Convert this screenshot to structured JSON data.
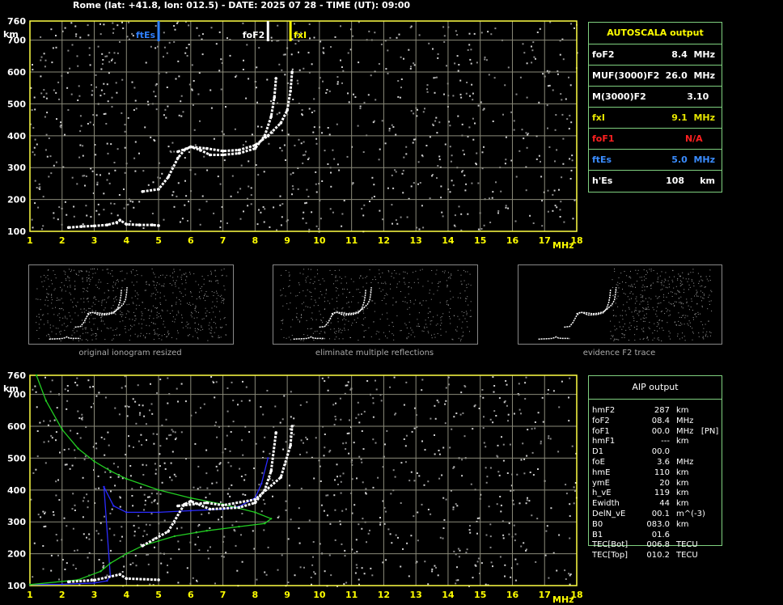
{
  "header": "Rome (lat: +41.8, lon: 012.5) - DATE: 2025 07 28 - TIME (UT): 09:00",
  "axis": {
    "x_unit": "MHz",
    "y_unit": "km",
    "x_ticks": [
      "1",
      "2",
      "3",
      "4",
      "5",
      "6",
      "7",
      "8",
      "9",
      "10",
      "11",
      "12",
      "13",
      "14",
      "15",
      "16",
      "17",
      "18"
    ],
    "y_ticks": [
      "100",
      "200",
      "300",
      "400",
      "500",
      "600",
      "700",
      "760"
    ]
  },
  "markers": {
    "ftEs": {
      "label": "ftEs",
      "freq": 5.0,
      "color": "#2f7fff"
    },
    "foF2": {
      "label": "foF2",
      "freq": 8.4,
      "color": "#ffffff"
    },
    "fxI": {
      "label": "fxI",
      "freq": 9.1,
      "color": "#ffff00"
    }
  },
  "autoscala": {
    "title": "AUTOSCALA output",
    "rows": [
      {
        "label": "foF2",
        "value": "8.4  MHz",
        "color": "#ffffff"
      },
      {
        "label": "MUF(3000)F2",
        "value": "26.0  MHz",
        "color": "#ffffff"
      },
      {
        "label": "M(3000)F2",
        "value": "3.10  ",
        "color": "#ffffff"
      },
      {
        "label": "fxI",
        "value": "9.1  MHz",
        "color": "#e6e600"
      },
      {
        "label": "foF1",
        "value": "N/A    ",
        "color": "#ff2020"
      },
      {
        "label": "ftEs",
        "value": "5.0  MHz",
        "color": "#3a8cff"
      },
      {
        "label": "h'Es",
        "value": "108     km",
        "color": "#ffffff"
      }
    ]
  },
  "thumbnails": [
    {
      "caption": "original ionogram resized"
    },
    {
      "caption": "eliminate multiple reflections"
    },
    {
      "caption": "evidence F2 trace"
    }
  ],
  "aip": {
    "title": "AIP output",
    "rows": [
      [
        "hmF2",
        "287",
        "km"
      ],
      [
        "foF2",
        "08.4",
        "MHz"
      ],
      [
        "foF1",
        "00.0",
        "MHz   [PN]"
      ],
      [
        "hmF1",
        "---",
        "km"
      ],
      [
        "D1",
        "00.0",
        ""
      ],
      [
        "foE",
        "3.6",
        "MHz"
      ],
      [
        "hmE",
        "110",
        "km"
      ],
      [
        "ymE",
        "20",
        "km"
      ],
      [
        "h_vE",
        "119",
        "km"
      ],
      [
        "Ewidth",
        "44",
        "km"
      ],
      [
        "DelN_vE",
        "00.1",
        "m^(-3)"
      ],
      [
        "B0",
        "083.0",
        "km"
      ],
      [
        "B1",
        "01.6",
        ""
      ],
      [
        "TEC[Bot]",
        "006.8",
        "TECU"
      ],
      [
        "TEC[Top]",
        "010.2",
        "TECU"
      ]
    ]
  },
  "chart_data": [
    {
      "type": "scatter",
      "title": "Rome (lat: +41.8, lon: 012.5) - DATE: 2025 07 28 - TIME (UT): 09:00",
      "xlabel": "MHz",
      "ylabel": "km",
      "xlim": [
        1,
        18
      ],
      "ylim": [
        100,
        760
      ],
      "grid": true,
      "series": [
        {
          "values": [
            [
              2.2,
              112
            ],
            [
              2.6,
              115
            ],
            [
              3.0,
              117
            ],
            [
              3.4,
              120
            ],
            [
              3.7,
              128
            ],
            [
              3.8,
              135
            ],
            [
              4.0,
              122
            ],
            [
              4.4,
              120
            ],
            [
              4.8,
              120
            ],
            [
              5.0,
              118
            ]
          ]
        },
        {
          "values": [
            [
              4.5,
              225
            ],
            [
              5.0,
              232
            ],
            [
              5.3,
              270
            ],
            [
              5.6,
              330
            ],
            [
              5.8,
              355
            ],
            [
              6.0,
              365
            ],
            [
              6.3,
              355
            ],
            [
              6.6,
              340
            ],
            [
              7.0,
              340
            ],
            [
              7.5,
              345
            ],
            [
              8.0,
              360
            ],
            [
              8.3,
              400
            ],
            [
              8.5,
              460
            ],
            [
              8.6,
              520
            ],
            [
              8.65,
              580
            ]
          ]
        },
        {
          "values": [
            [
              5.6,
              350
            ],
            [
              6.0,
              365
            ],
            [
              6.5,
              360
            ],
            [
              7.0,
              352
            ],
            [
              7.5,
              355
            ],
            [
              8.0,
              370
            ],
            [
              8.4,
              400
            ],
            [
              8.8,
              440
            ],
            [
              9.0,
              480
            ],
            [
              9.1,
              540
            ],
            [
              9.15,
              600
            ]
          ]
        }
      ]
    },
    {
      "type": "line",
      "xlabel": "MHz",
      "ylabel": "km",
      "xlim": [
        1,
        18
      ],
      "ylim": [
        100,
        760
      ],
      "grid": true,
      "series": [
        {
          "color": "#2b2bff",
          "values": [
            [
              1.0,
              103
            ],
            [
              2.0,
              104
            ],
            [
              3.0,
              108
            ],
            [
              3.4,
              115
            ],
            [
              3.5,
              130
            ],
            [
              3.3,
              410
            ],
            [
              3.6,
              350
            ],
            [
              4.0,
              330
            ],
            [
              5.0,
              330
            ],
            [
              6.0,
              335
            ],
            [
              7.0,
              340
            ],
            [
              7.5,
              348
            ],
            [
              8.0,
              375
            ],
            [
              8.2,
              420
            ],
            [
              8.4,
              500
            ]
          ]
        },
        {
          "color": "#22cc22",
          "values": [
            [
              1.2,
              760
            ],
            [
              1.5,
              680
            ],
            [
              2.0,
              590
            ],
            [
              2.5,
              530
            ],
            [
              3.0,
              490
            ],
            [
              3.5,
              460
            ],
            [
              4.0,
              435
            ],
            [
              5.0,
              400
            ],
            [
              6.0,
              375
            ],
            [
              7.0,
              355
            ],
            [
              8.0,
              330
            ],
            [
              8.5,
              310
            ],
            [
              8.3,
              295
            ],
            [
              7.5,
              285
            ],
            [
              6.5,
              272
            ],
            [
              5.5,
              255
            ],
            [
              5.0,
              240
            ],
            [
              4.5,
              225
            ],
            [
              4.0,
              200
            ],
            [
              3.5,
              170
            ],
            [
              3.2,
              145
            ],
            [
              2.5,
              118
            ],
            [
              1.0,
              103
            ]
          ]
        },
        {
          "color": "#ffffff",
          "values": [
            [
              2.2,
              112
            ],
            [
              3.0,
              117
            ],
            [
              3.8,
              135
            ],
            [
              4.0,
              122
            ],
            [
              5.0,
              118
            ]
          ]
        },
        {
          "color": "#ffffff",
          "values": [
            [
              4.5,
              225
            ],
            [
              5.3,
              270
            ],
            [
              5.8,
              355
            ],
            [
              6.0,
              365
            ],
            [
              6.6,
              340
            ],
            [
              7.5,
              345
            ],
            [
              8.0,
              360
            ],
            [
              8.3,
              400
            ],
            [
              8.5,
              460
            ],
            [
              8.65,
              580
            ]
          ]
        },
        {
          "color": "#ffffff",
          "values": [
            [
              5.6,
              350
            ],
            [
              6.5,
              360
            ],
            [
              7.0,
              352
            ],
            [
              8.0,
              370
            ],
            [
              8.8,
              440
            ],
            [
              9.1,
              540
            ],
            [
              9.15,
              600
            ]
          ]
        }
      ]
    }
  ]
}
